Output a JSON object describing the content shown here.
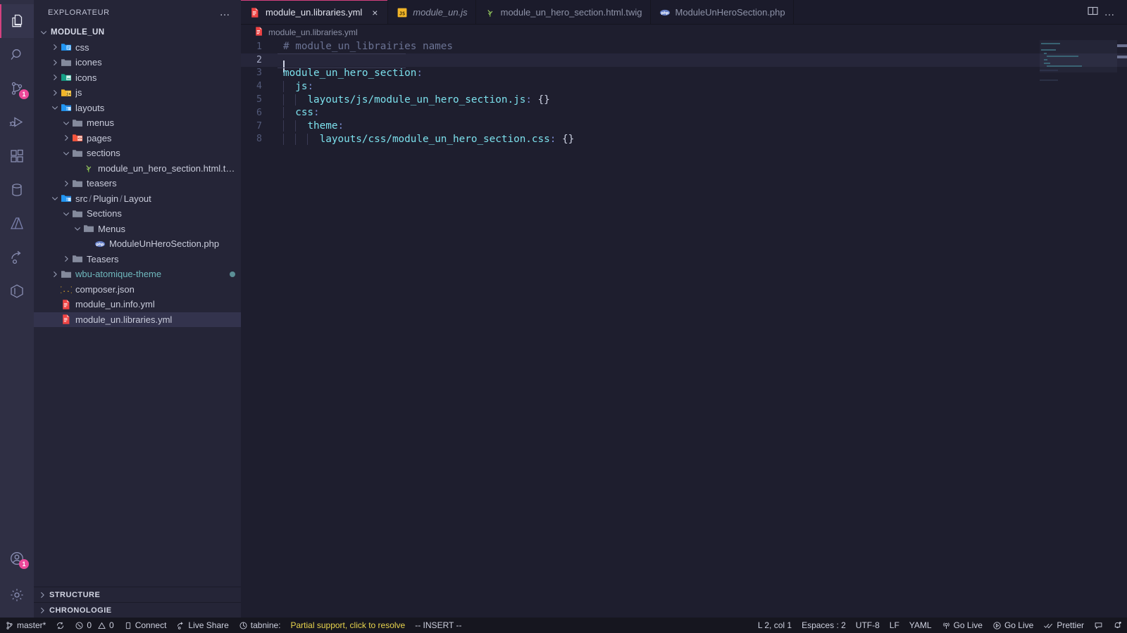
{
  "activitybar": {
    "items": [
      {
        "name": "explorer",
        "icon": "files-icon",
        "active": true,
        "badge": null
      },
      {
        "name": "search",
        "icon": "search-icon",
        "active": false,
        "badge": null
      },
      {
        "name": "source-control",
        "icon": "source-control-icon",
        "active": false,
        "badge": "1"
      },
      {
        "name": "run-and-debug",
        "icon": "debug-icon",
        "active": false,
        "badge": null
      },
      {
        "name": "extensions",
        "icon": "extensions-icon",
        "active": false,
        "badge": null
      },
      {
        "name": "database",
        "icon": "database-icon",
        "active": false,
        "badge": null
      },
      {
        "name": "azure",
        "icon": "azure-icon",
        "active": false,
        "badge": null
      },
      {
        "name": "live-share",
        "icon": "live-share-icon",
        "active": false,
        "badge": null
      },
      {
        "name": "docker",
        "icon": "docker-icon",
        "active": false,
        "badge": null
      }
    ],
    "bottom": [
      {
        "name": "accounts",
        "icon": "account-icon",
        "badge": "1"
      },
      {
        "name": "manage",
        "icon": "gear-icon",
        "badge": null
      }
    ]
  },
  "sidebar": {
    "title": "EXPLORATEUR",
    "more_actions": "…",
    "tree": [
      {
        "label": "MODULE_UN",
        "depth": 0,
        "kind": "root",
        "twisty": "down",
        "icon": null
      },
      {
        "label": "css",
        "depth": 1,
        "kind": "folder",
        "twisty": "right",
        "icon": "folder-css-icon"
      },
      {
        "label": "icones",
        "depth": 1,
        "kind": "folder",
        "twisty": "right",
        "icon": "folder-icon"
      },
      {
        "label": "icons",
        "depth": 1,
        "kind": "folder",
        "twisty": "right",
        "icon": "folder-images-icon"
      },
      {
        "label": "js",
        "depth": 1,
        "kind": "folder",
        "twisty": "right",
        "icon": "folder-js-icon"
      },
      {
        "label": "layouts",
        "depth": 1,
        "kind": "folder",
        "twisty": "down",
        "icon": "folder-layout-icon"
      },
      {
        "label": "menus",
        "depth": 2,
        "kind": "folder",
        "twisty": "down",
        "icon": "folder-icon"
      },
      {
        "label": "pages",
        "depth": 2,
        "kind": "folder",
        "twisty": "right",
        "icon": "folder-pages-icon"
      },
      {
        "label": "sections",
        "depth": 2,
        "kind": "folder",
        "twisty": "down",
        "icon": "folder-icon"
      },
      {
        "label": "module_un_hero_section.html.twig",
        "depth": 3,
        "kind": "file",
        "twisty": "none",
        "icon": "twig-icon"
      },
      {
        "label": "teasers",
        "depth": 2,
        "kind": "folder",
        "twisty": "right",
        "icon": "folder-icon"
      },
      {
        "label": "src / Plugin / Layout",
        "depth": 1,
        "kind": "folder-compact",
        "twisty": "down",
        "icon": "folder-layout-icon"
      },
      {
        "label": "Sections",
        "depth": 2,
        "kind": "folder",
        "twisty": "down",
        "icon": "folder-icon"
      },
      {
        "label": "Menus",
        "depth": 3,
        "kind": "folder",
        "twisty": "down",
        "icon": "folder-icon"
      },
      {
        "label": "ModuleUnHeroSection.php",
        "depth": 4,
        "kind": "file",
        "twisty": "none",
        "icon": "php-icon"
      },
      {
        "label": "Teasers",
        "depth": 2,
        "kind": "folder",
        "twisty": "right",
        "icon": "folder-icon"
      },
      {
        "label": "wbu-atomique-theme",
        "depth": 1,
        "kind": "folder",
        "twisty": "right",
        "icon": "folder-icon",
        "color": "teal",
        "modified": true
      },
      {
        "label": "composer.json",
        "depth": 1,
        "kind": "file",
        "twisty": "none",
        "icon": "json-icon"
      },
      {
        "label": "module_un.info.yml",
        "depth": 1,
        "kind": "file",
        "twisty": "none",
        "icon": "yaml-icon"
      },
      {
        "label": "module_un.libraries.yml",
        "depth": 1,
        "kind": "file",
        "twisty": "none",
        "icon": "yaml-icon",
        "selected": true
      }
    ],
    "panels": [
      {
        "label": "STRUCTURE",
        "collapsed": true
      },
      {
        "label": "CHRONOLOGIE",
        "collapsed": true
      }
    ]
  },
  "editor": {
    "tabs": [
      {
        "label": "module_un.libraries.yml",
        "icon": "yaml-icon",
        "active": true,
        "italic": false,
        "close": "×"
      },
      {
        "label": "module_un.js",
        "icon": "js-icon",
        "active": false,
        "italic": true,
        "close": ""
      },
      {
        "label": "module_un_hero_section.html.twig",
        "icon": "twig-icon",
        "active": false,
        "italic": false,
        "close": ""
      },
      {
        "label": "ModuleUnHeroSection.php",
        "icon": "php-icon",
        "active": false,
        "italic": false,
        "close": ""
      }
    ],
    "tab_actions": [
      {
        "name": "split-editor-right-button",
        "icon": "split-editor-icon"
      },
      {
        "name": "more-editor-actions-button",
        "icon": "ellipsis-icon",
        "glyph": "…"
      }
    ],
    "breadcrumb": {
      "icon": "yaml-icon",
      "label": "module_un.libraries.yml"
    },
    "lines": [
      {
        "n": "1",
        "current": false,
        "tokens": [
          {
            "t": "# module_un_librairies names",
            "c": "cm"
          }
        ]
      },
      {
        "n": "2",
        "current": true,
        "tokens": []
      },
      {
        "n": "3",
        "current": false,
        "tokens": [
          {
            "t": "module_un_hero_section",
            "c": "key"
          },
          {
            "t": ":",
            "c": "colon"
          }
        ]
      },
      {
        "n": "4",
        "current": false,
        "tokens": [
          {
            "t": "  ",
            "c": "pl"
          },
          {
            "t": "js",
            "c": "key"
          },
          {
            "t": ":",
            "c": "colon"
          }
        ]
      },
      {
        "n": "5",
        "current": false,
        "tokens": [
          {
            "t": "    ",
            "c": "pl"
          },
          {
            "t": "layouts/js/module_un_hero_section.js",
            "c": "key"
          },
          {
            "t": ":",
            "c": "colon"
          },
          {
            "t": " {}",
            "c": "brace"
          }
        ]
      },
      {
        "n": "6",
        "current": false,
        "tokens": [
          {
            "t": "  ",
            "c": "pl"
          },
          {
            "t": "css",
            "c": "key"
          },
          {
            "t": ":",
            "c": "colon"
          }
        ]
      },
      {
        "n": "7",
        "current": false,
        "tokens": [
          {
            "t": "    ",
            "c": "pl"
          },
          {
            "t": "theme",
            "c": "key"
          },
          {
            "t": ":",
            "c": "colon"
          }
        ]
      },
      {
        "n": "8",
        "current": false,
        "tokens": [
          {
            "t": "      ",
            "c": "pl"
          },
          {
            "t": "layouts/css/module_un_hero_section.css",
            "c": "key"
          },
          {
            "t": ":",
            "c": "colon"
          },
          {
            "t": " {}",
            "c": "brace"
          }
        ]
      }
    ]
  },
  "statusbar": {
    "left": [
      {
        "name": "branch-status",
        "icon": "source-control-icon",
        "label": "master*"
      },
      {
        "name": "sync-status",
        "icon": "sync-icon",
        "label": ""
      },
      {
        "name": "problems-status",
        "icon": "error-warning-icon",
        "label": "0  0",
        "errors": "0",
        "warnings": "0"
      },
      {
        "name": "remote-connect-status",
        "icon": "remote-icon",
        "label": "Connect"
      },
      {
        "name": "live-share-status",
        "icon": "live-share-icon",
        "label": "Live Share"
      },
      {
        "name": "tabnine-status",
        "icon": "tabnine-icon",
        "label": "tabnine:"
      },
      {
        "name": "tabnine-support-status",
        "icon": null,
        "label": "Partial support, click to resolve",
        "warn": true
      },
      {
        "name": "vim-mode-status",
        "icon": null,
        "label": "-- INSERT --"
      }
    ],
    "right": [
      {
        "name": "cursor-position-status",
        "icon": null,
        "label": "L 2, col 1"
      },
      {
        "name": "indentation-status",
        "icon": null,
        "label": "Espaces : 2"
      },
      {
        "name": "encoding-status",
        "icon": null,
        "label": "UTF-8"
      },
      {
        "name": "eol-status",
        "icon": null,
        "label": "LF"
      },
      {
        "name": "language-mode-status",
        "icon": null,
        "label": "YAML"
      },
      {
        "name": "go-live-status",
        "icon": "broadcast-icon",
        "label": "Go Live"
      },
      {
        "name": "go-live-2-status",
        "icon": "play-circle-icon",
        "label": "Go Live"
      },
      {
        "name": "prettier-status",
        "icon": "check-check-icon",
        "label": "Prettier"
      },
      {
        "name": "feedback-status",
        "icon": "feedback-icon",
        "label": ""
      },
      {
        "name": "notifications-status",
        "icon": "bell-dot-icon",
        "label": ""
      }
    ]
  },
  "colors": {
    "accent": "#d5417f",
    "badge": "#ec4899",
    "warning_text": "#e8d44d",
    "editor_bg": "#1e1e2e",
    "sidebar_bg": "#252537",
    "activitybar_bg": "#2f2f44",
    "statusbar_bg": "#16161f",
    "yaml_key": "#7ce0ec",
    "comment": "#6b7394",
    "teal_folder": "#6fb8bd"
  }
}
